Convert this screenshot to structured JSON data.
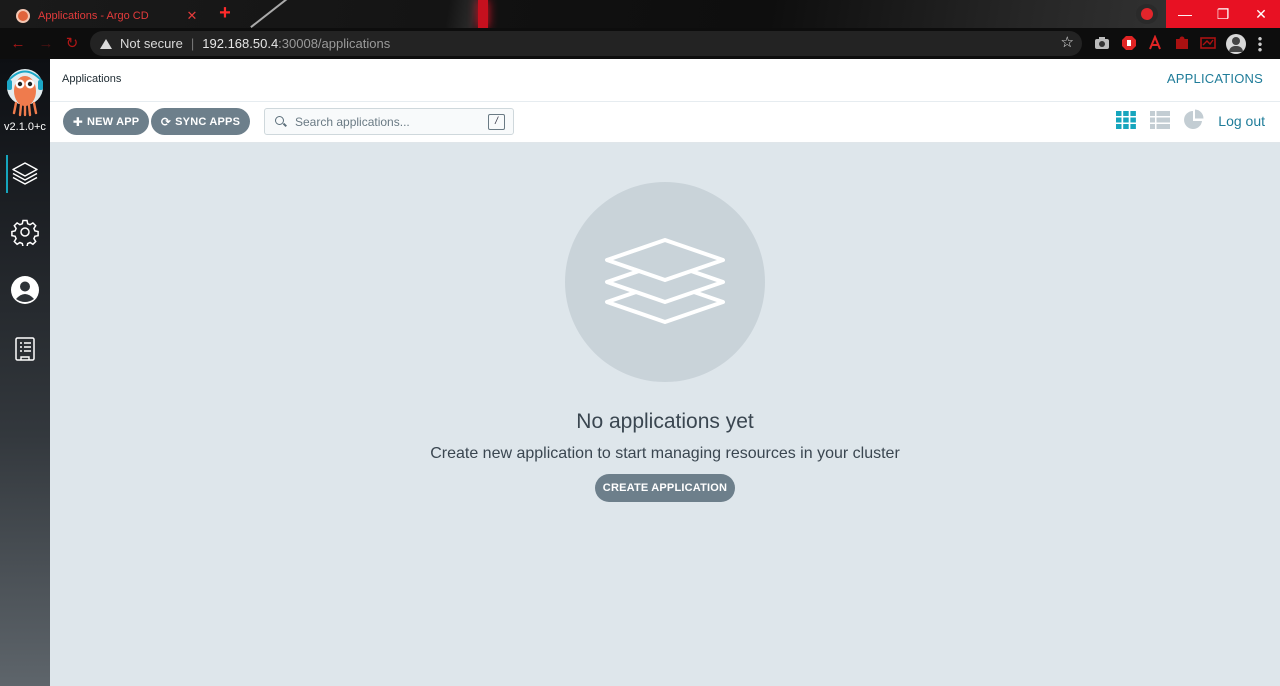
{
  "browser": {
    "tab_title": "Applications - Argo CD",
    "security_label": "Not secure",
    "url_host": "192.168.50.4",
    "url_rest": ":30008/applications"
  },
  "sidebar": {
    "version": "v2.1.0+c",
    "items": [
      {
        "name": "applications",
        "icon": "layers-icon"
      },
      {
        "name": "settings",
        "icon": "gear-icon"
      },
      {
        "name": "user-info",
        "icon": "user-icon"
      },
      {
        "name": "documentation",
        "icon": "docs-icon"
      }
    ]
  },
  "topbar": {
    "breadcrumb": "Applications",
    "title": "APPLICATIONS"
  },
  "actions": {
    "new_app": "NEW APP",
    "sync_apps": "SYNC APPS",
    "search_placeholder": "Search applications...",
    "search_shortcut": "/",
    "logout": "Log out"
  },
  "empty_state": {
    "title": "No applications yet",
    "description": "Create new application to start managing resources in your cluster",
    "button": "CREATE APPLICATION"
  },
  "colors": {
    "accent": "#1f7c99",
    "active_view": "#16a5bd",
    "button": "#6d7f8b",
    "background": "#dee6eb"
  }
}
